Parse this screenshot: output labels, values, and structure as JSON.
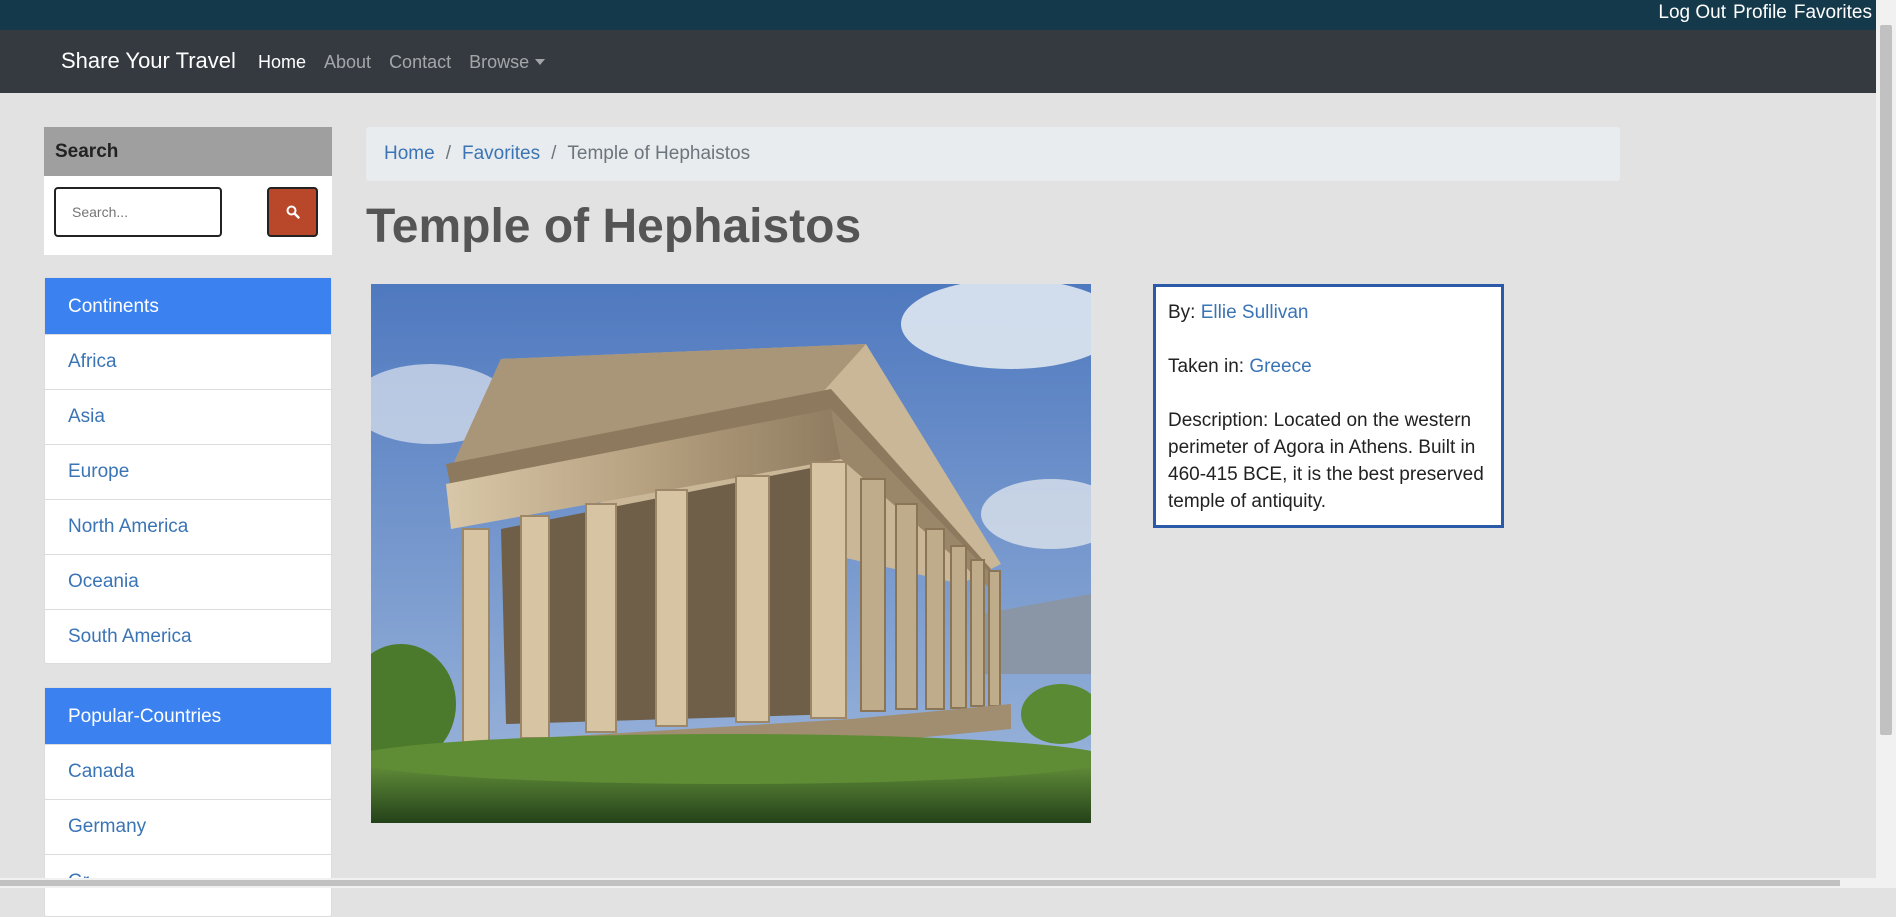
{
  "topbar": {
    "links": [
      "Log Out",
      "Profile",
      "Favorites"
    ]
  },
  "navbar": {
    "brand": "Share Your Travel",
    "items": [
      {
        "label": "Home",
        "active": true
      },
      {
        "label": "About",
        "active": false
      },
      {
        "label": "Contact",
        "active": false
      },
      {
        "label": "Browse",
        "active": false,
        "dropdown": true
      }
    ]
  },
  "sidebar": {
    "search": {
      "header": "Search",
      "placeholder": "Search..."
    },
    "continents": {
      "header": "Continents",
      "items": [
        "Africa",
        "Asia",
        "Europe",
        "North America",
        "Oceania",
        "South America"
      ]
    },
    "countries": {
      "header": "Popular-Countries",
      "items": [
        "Canada",
        "Germany",
        "Gr..."
      ]
    }
  },
  "breadcrumb": {
    "home": "Home",
    "favorites": "Favorites",
    "current": "Temple of Hephaistos"
  },
  "page_title": "Temple of Hephaistos",
  "photo": {
    "subject": "Temple of Hephaistos"
  },
  "info": {
    "by_label": "By:",
    "by_value": "Ellie Sullivan",
    "taken_label": "Taken in:",
    "taken_value": "Greece",
    "description": "Description: Located on the western perimeter of Agora in Athens. Built in 460-415 BCE, it is the best preserved temple of antiquity."
  },
  "colors": {
    "topbar": "#14394b",
    "navbar": "#343a40",
    "accent": "#3b82f0",
    "link": "#3a74b5",
    "search_button": "#b9472a",
    "info_border": "#2b5aa8"
  }
}
